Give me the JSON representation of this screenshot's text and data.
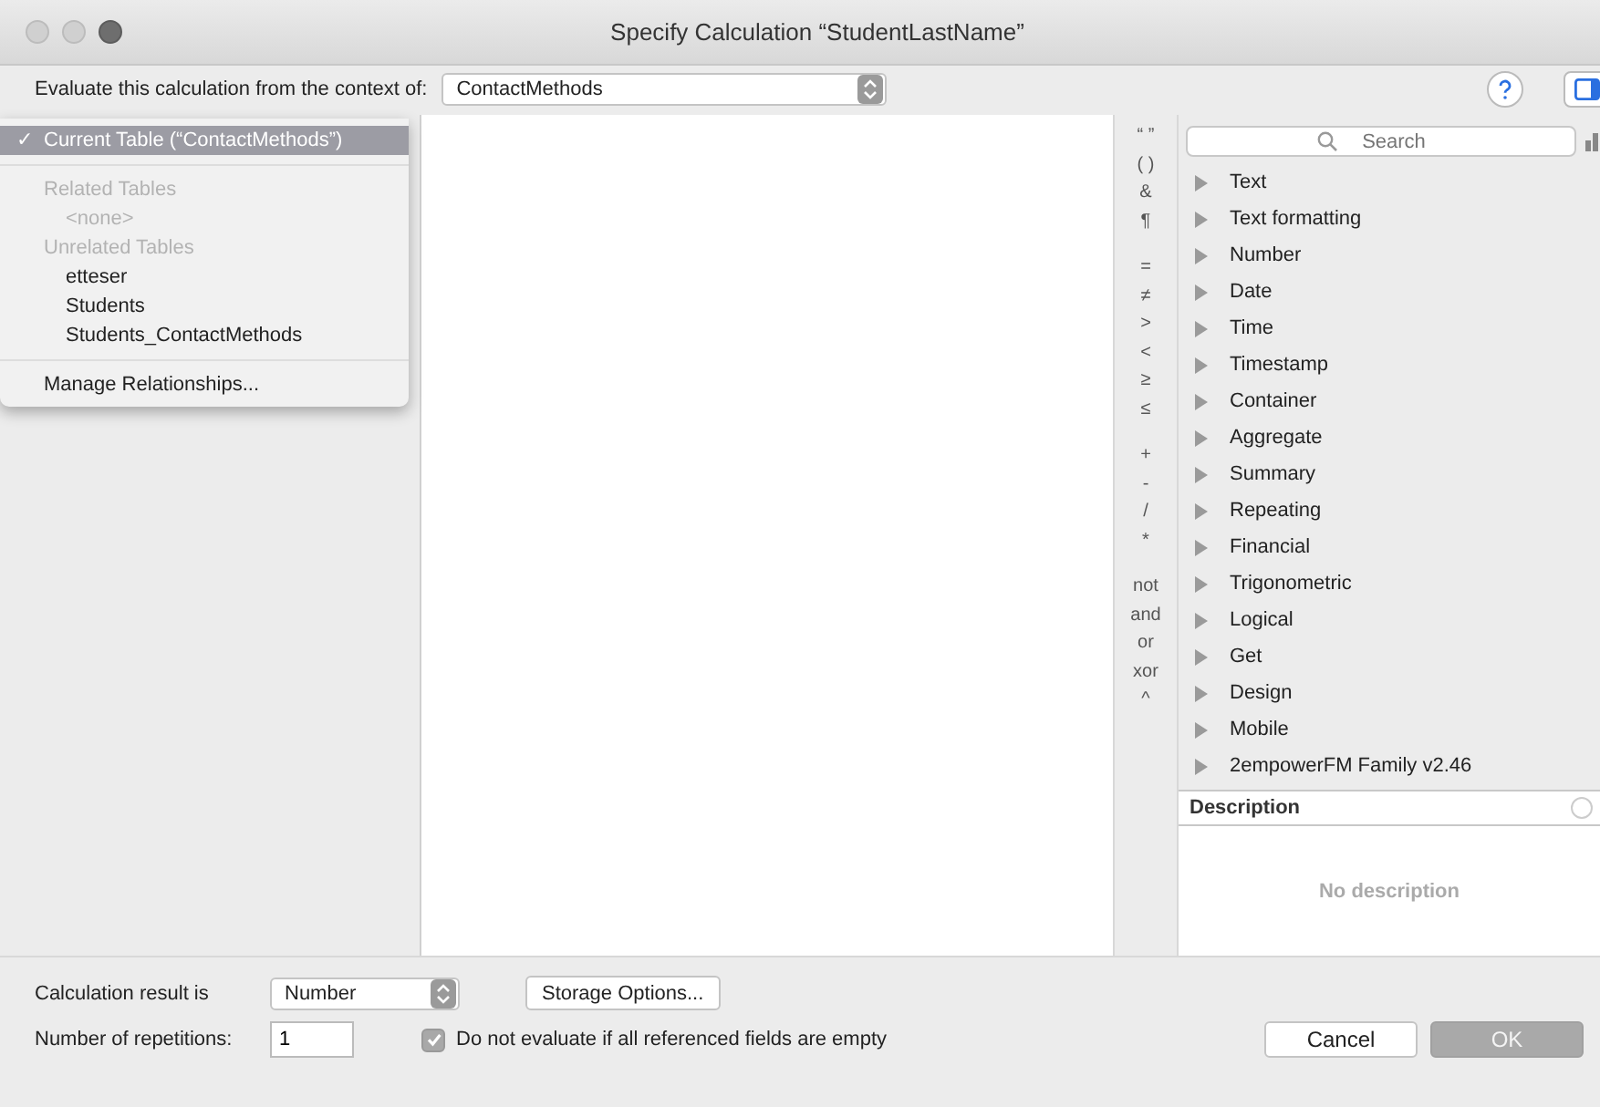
{
  "window": {
    "title": "Specify Calculation “StudentLastName”"
  },
  "context": {
    "label": "Evaluate this calculation from the context of:",
    "value": "ContactMethods"
  },
  "menu_check": "✓",
  "table_menu": [
    {
      "kind": "item",
      "label": "Current Table (“ContactMethods”)",
      "selected": true,
      "disabled": false
    },
    {
      "kind": "separator"
    },
    {
      "kind": "header",
      "label": "Related Tables",
      "selected": false,
      "disabled": true
    },
    {
      "kind": "sub",
      "label": "<none>",
      "selected": false,
      "disabled": true
    },
    {
      "kind": "header",
      "label": "Unrelated Tables",
      "selected": false,
      "disabled": true
    },
    {
      "kind": "sub",
      "label": "etteser",
      "selected": false,
      "disabled": false
    },
    {
      "kind": "sub",
      "label": "Students",
      "selected": false,
      "disabled": false
    },
    {
      "kind": "sub",
      "label": "Students_ContactMethods",
      "selected": false,
      "disabled": false
    },
    {
      "kind": "separator"
    },
    {
      "kind": "item",
      "label": "Manage Relationships...",
      "selected": false,
      "disabled": false
    }
  ],
  "operators": [
    [
      "“ ”",
      "( )",
      "&",
      "¶"
    ],
    [
      "=",
      "≠",
      ">",
      "<",
      "≥",
      "≤"
    ],
    [
      "+",
      "-",
      "/",
      "*"
    ],
    [
      "not",
      "and",
      "or",
      "xor",
      "^"
    ]
  ],
  "search": {
    "placeholder": "Search"
  },
  "functions": [
    "Text",
    "Text formatting",
    "Number",
    "Date",
    "Time",
    "Timestamp",
    "Container",
    "Aggregate",
    "Summary",
    "Repeating",
    "Financial",
    "Trigonometric",
    "Logical",
    "Get",
    "Design",
    "Mobile",
    "2empowerFM Family v2.46"
  ],
  "description": {
    "title": "Description",
    "text": "No description"
  },
  "result": {
    "label": "Calculation result is",
    "value": "Number",
    "storage_button": "Storage Options..."
  },
  "repetitions": {
    "label": "Number of repetitions:",
    "value": "1"
  },
  "do_not_evaluate": {
    "label": "Do not evaluate if all referenced fields are empty",
    "checked": true
  },
  "buttons": [
    {
      "label": "Cancel",
      "default": false
    },
    {
      "label": "OK",
      "default": true
    }
  ]
}
